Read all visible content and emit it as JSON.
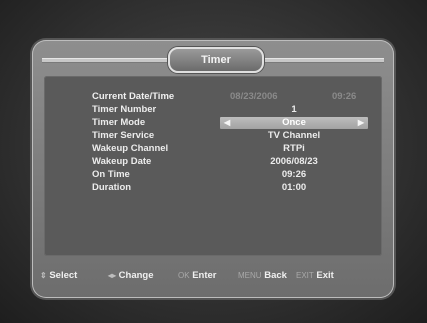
{
  "title": "Timer",
  "rows": [
    {
      "label": "Current Date/Time",
      "value_date": "08/23/2006",
      "value_time": "09:26"
    },
    {
      "label": "Timer Number",
      "value": "1"
    },
    {
      "label": "Timer Mode",
      "value": "Once"
    },
    {
      "label": "Timer Service",
      "value": "TV Channel"
    },
    {
      "label": "Wakeup Channel",
      "value": "RTPi"
    },
    {
      "label": "Wakeup Date",
      "value": "2006/08/23"
    },
    {
      "label": "On Time",
      "value": "09:26"
    },
    {
      "label": "Duration",
      "value": "01:00"
    }
  ],
  "footer": {
    "select_label": "Select",
    "change_label": "Change",
    "ok_key": "OK",
    "enter_label": "Enter",
    "menu_key": "MENU",
    "back_label": "Back",
    "exit_key": "EXIT",
    "exit_label": "Exit"
  },
  "icons": {
    "select": "up-down-arrows-icon",
    "change": "left-right-arrows-icon"
  },
  "colors": {
    "frame": "#7d7d7d",
    "panel": "#5a5a5a",
    "highlight": "#b0b0b0",
    "text": "#ececec"
  }
}
